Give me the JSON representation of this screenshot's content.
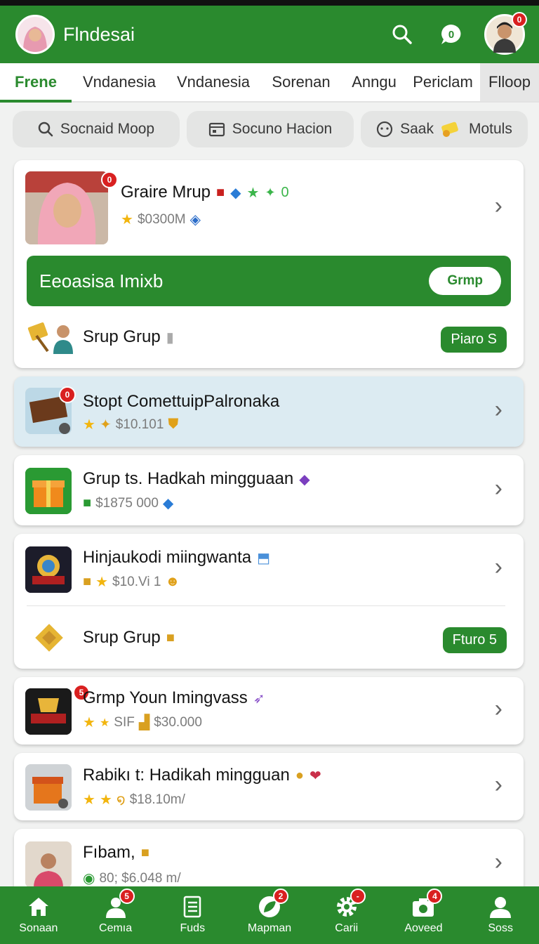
{
  "app": {
    "title": "Flndesai"
  },
  "tabs": [
    "Frene",
    "Vndanesia",
    "Vndanesia",
    "Sorenan",
    "Anngu",
    "Periclam",
    "Flloop"
  ],
  "chips": [
    "Socnaid Moop",
    "Socuno Hacion",
    "Saak",
    "Motuls"
  ],
  "header_badge": "0",
  "card1": {
    "title": "Graire Mrup",
    "title_extra": "0",
    "meta": "$0300M",
    "thumb_badge": "0",
    "banner_text": "Eeoasisa Imixb",
    "banner_button": "Grmp",
    "sub_title": "Srup Grup",
    "sub_pill": "Piaro S"
  },
  "rows": [
    {
      "title": "Stopt ComettuipPalronaka",
      "meta": "$10.101",
      "thumb_badge": "0"
    },
    {
      "title": "Grup ts. Hadkah mingguaan",
      "meta": "$1875 000"
    },
    {
      "title": "Hinjaukodi miingwanta",
      "meta": "$10.Vi 1",
      "sub_title": "Srup Grup",
      "sub_pill": "Fturo 5"
    },
    {
      "title": "Grmp Youn Imingvass",
      "meta_prefix": "SIF",
      "meta": "$30.000",
      "thumb_badge": "5"
    },
    {
      "title": "Rabikı t: Hadikah mingguan",
      "meta": "$18.10m/"
    },
    {
      "title": "Fıbam,",
      "meta": "80; $6.048 m/"
    }
  ],
  "nav": [
    {
      "label": "Sonaan",
      "icon": "home-icon"
    },
    {
      "label": "Cemıa",
      "icon": "person-icon",
      "badge": "5"
    },
    {
      "label": "Fuds",
      "icon": "list-icon"
    },
    {
      "label": "Mapman",
      "icon": "leaf-icon",
      "badge": "2"
    },
    {
      "label": "Carii",
      "icon": "gear-icon",
      "badge": "-"
    },
    {
      "label": "Aoveed",
      "icon": "camera-icon",
      "badge": "4"
    },
    {
      "label": "Soss",
      "icon": "profile-icon"
    }
  ],
  "colors": {
    "brand_green": "#2a8a2e",
    "badge_red": "#d92020",
    "star": "#f2b50e",
    "highlight": "#dcebf2"
  }
}
